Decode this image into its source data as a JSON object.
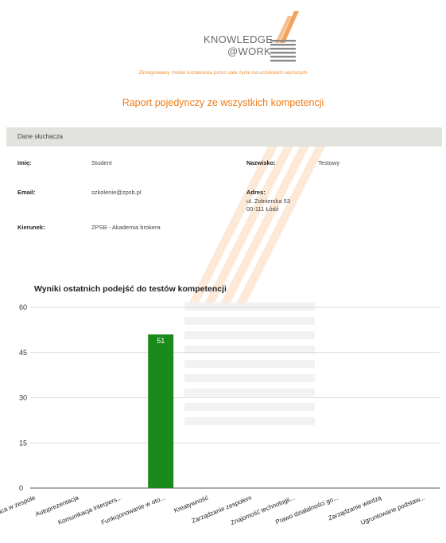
{
  "logo": {
    "line1": "KNOWLEDGE",
    "line2": "@WORK"
  },
  "tagline": "Zintegrowany model kształcenia przez całe życie na uczelniach wyższych",
  "report_title": "Raport pojedynczy ze wszystkich kompetencji",
  "section": {
    "title": "Dane słuchacza"
  },
  "student": {
    "first_name_label": "Imię:",
    "first_name": "Student",
    "last_name_label": "Nazwisko:",
    "last_name": "Testowy",
    "email_label": "Email:",
    "email": "szkolenie@zpsb.pl",
    "address_label": "Adres:",
    "address_line1": "ul. Żołnierska 53",
    "address_line2": "00-111 Łódź",
    "course_label": "Kierunek:",
    "course": "ZPSB - Akademia brokera"
  },
  "chart_data": {
    "type": "bar",
    "title": "Wyniki ostatnich podejść do testów kompetencji",
    "categories": [
      "Praca w zespole",
      "Autoprezentacja",
      "Komunikacja interpers...",
      "Funkcjonowanie w oto...",
      "Kreatywność",
      "Zarządzanie zespołem",
      "Znajomość technologii...",
      "Prawo działalności go...",
      "Zarządzanie wiedzą",
      "Ugruntowane podstaw..."
    ],
    "values": [
      0,
      0,
      0,
      51,
      0,
      0,
      0,
      0,
      0,
      0
    ],
    "data_labels": [
      "",
      "",
      "",
      "51",
      "",
      "",
      "",
      "",
      "",
      ""
    ],
    "ylim": [
      0,
      60
    ],
    "yticks": [
      "0",
      "15",
      "30",
      "45",
      "60"
    ],
    "grid": true,
    "bar_color": "#1a8a1a",
    "xlabel": "",
    "ylabel": ""
  }
}
